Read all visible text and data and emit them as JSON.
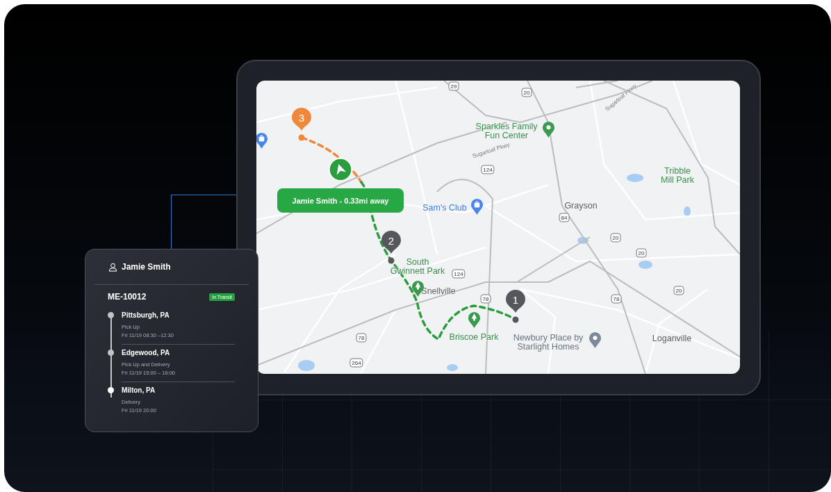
{
  "map": {
    "labels": [
      {
        "kind": "place",
        "text": "Sparkles Family\nFun Center"
      },
      {
        "kind": "park",
        "text": "Tribble\nMill Park"
      },
      {
        "kind": "town",
        "text": "Grayson"
      },
      {
        "kind": "shop",
        "text": "Sam's Club"
      },
      {
        "kind": "park",
        "text": "South\nGwinnett Park"
      },
      {
        "kind": "town",
        "text": "Snellville"
      },
      {
        "kind": "park",
        "text": "Briscoe Park"
      },
      {
        "kind": "poi",
        "text": "Newbury Place by\nStarlight Homes"
      },
      {
        "kind": "town",
        "text": "Loganville"
      },
      {
        "kind": "road",
        "text": "Sugarloaf Pkwy"
      },
      {
        "kind": "road",
        "text": "Sugarloaf Pkwy"
      },
      {
        "kind": "shield",
        "text": "29"
      },
      {
        "kind": "shield",
        "text": "20"
      },
      {
        "kind": "shield",
        "text": "124"
      },
      {
        "kind": "shield",
        "text": "84"
      },
      {
        "kind": "shield",
        "text": "124"
      },
      {
        "kind": "shield",
        "text": "78"
      },
      {
        "kind": "shield",
        "text": "78"
      },
      {
        "kind": "shield",
        "text": "264"
      },
      {
        "kind": "shield",
        "text": "20"
      },
      {
        "kind": "shield",
        "text": "20"
      },
      {
        "kind": "shield",
        "text": "20"
      },
      {
        "kind": "shield",
        "text": "78"
      }
    ],
    "markers": [
      {
        "number": "3",
        "color": "#f0883a"
      },
      {
        "number": "2",
        "color": "#55575c"
      },
      {
        "number": "1",
        "color": "#55575c"
      }
    ],
    "callout": "Jamie Smith - 0.33mi away"
  },
  "driver_card": {
    "name": "Jamie Smith",
    "order_id": "ME-10012",
    "status": "In Transit",
    "stops": [
      {
        "city": "Pittsburgh, PA",
        "type": "Pick Up",
        "time": "Fri 11/19 08:30 –12:30",
        "current": false
      },
      {
        "city": "Edgewood, PA",
        "type": "Pick Up and Delivery",
        "time": "Fri 11/19 15:00 – 16:00",
        "current": false
      },
      {
        "city": "Milton, PA",
        "type": "Delivery",
        "time": "Fri 11/19 20:00",
        "current": true
      }
    ]
  }
}
